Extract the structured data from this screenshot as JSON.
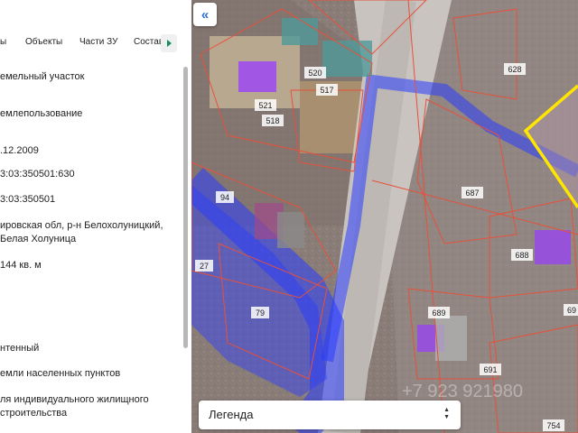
{
  "tabs": [
    "ы",
    "Объекты",
    "Части ЗУ",
    "Состав"
  ],
  "info": [
    "емельный участок",
    "емлепользование",
    ".12.2009",
    "3:03:350501:630",
    "3:03:350501",
    "ировская обл, р-н Белохолуницкий,",
    "Белая Холуница",
    "144 кв. м",
    "нтенный",
    "емли населенных пунктов",
    "ля индивидуального жилищного",
    "строительства"
  ],
  "map": {
    "collapse_glyph": "«",
    "parcel_labels": [
      "628",
      "520",
      "517",
      "521",
      "518",
      "687",
      "94",
      "688",
      "27",
      "79",
      "689",
      "69",
      "691",
      "754"
    ],
    "watermark": "+7 923 921980"
  },
  "legend": {
    "label": "Легенда",
    "arrow_up": "▲",
    "arrow_down": "▼"
  },
  "colors": {
    "selected_parcel": "#ffe600",
    "zone_blue": "#2a3cff",
    "building_purple": "#9a3cff",
    "boundary": "#e8503a"
  }
}
